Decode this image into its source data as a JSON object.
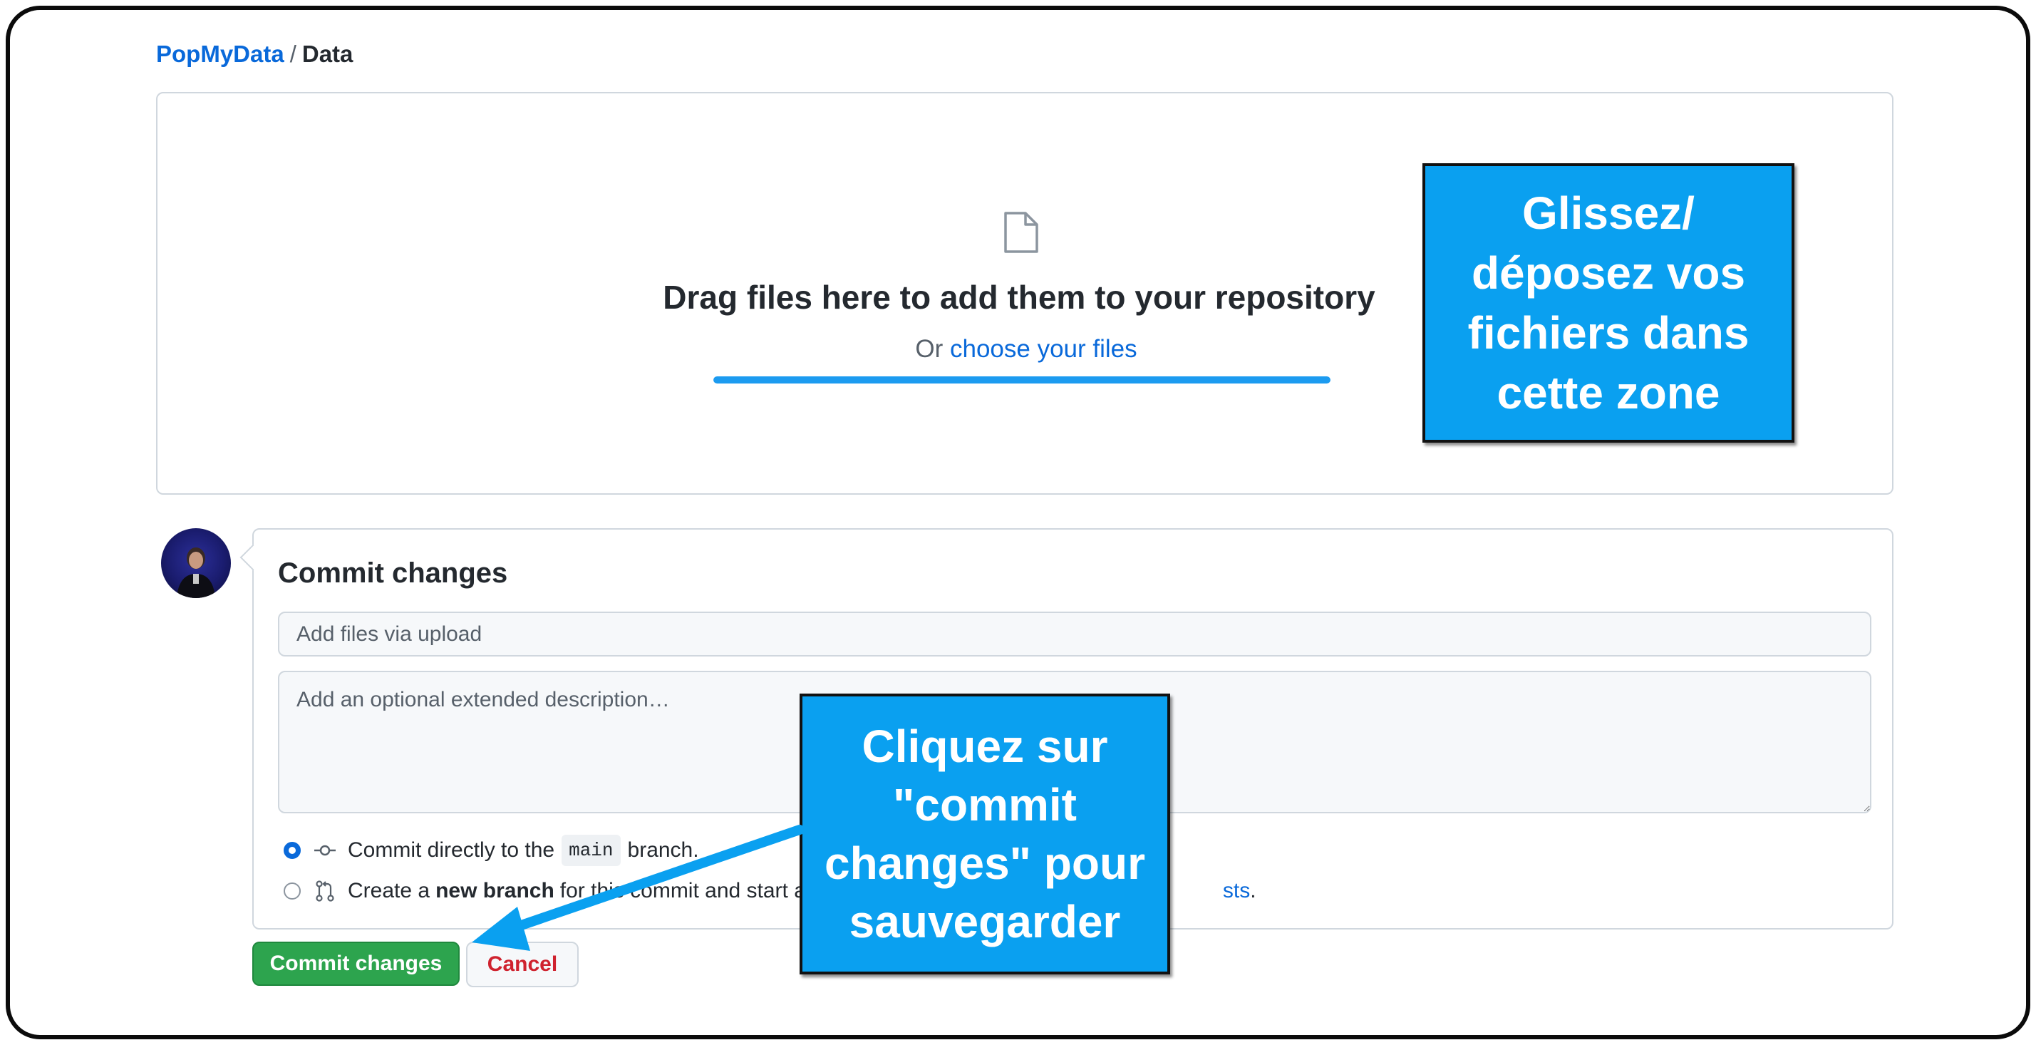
{
  "breadcrumb": {
    "owner": "PopMyData",
    "separator": "/",
    "repo": "Data"
  },
  "dropzone": {
    "icon": "file-icon",
    "title": "Drag files here to add them to your repository",
    "subtitle_prefix": "Or",
    "choose_link": "choose your files",
    "upload_progress": 1.0
  },
  "commit": {
    "title": "Commit changes",
    "summary_placeholder": "Add files via upload",
    "description_placeholder": "Add an optional extended description…",
    "options": [
      {
        "selected": true,
        "icon": "git-commit-icon",
        "text_before": "Commit directly to the",
        "branch": "main",
        "text_after": "branch."
      },
      {
        "selected": false,
        "icon": "git-pull-request-icon",
        "text_before": "Create a",
        "bold": "new branch",
        "text_middle": "for this commit and start a p",
        "link_text": "sts",
        "text_after": "."
      }
    ],
    "submit_label": "Commit changes",
    "cancel_label": "Cancel"
  },
  "annotations": {
    "drop_callout": [
      "Glissez/",
      "déposez vos",
      "fichiers dans",
      "cette zone"
    ],
    "commit_callout": [
      "Cliquez sur",
      "\"commit",
      "changes\" pour",
      "sauvegarder"
    ]
  },
  "colors": {
    "link": "#0969da",
    "primary_button": "#2da44e",
    "danger_text": "#cf222e",
    "callout_bg": "#0aa0f0"
  }
}
